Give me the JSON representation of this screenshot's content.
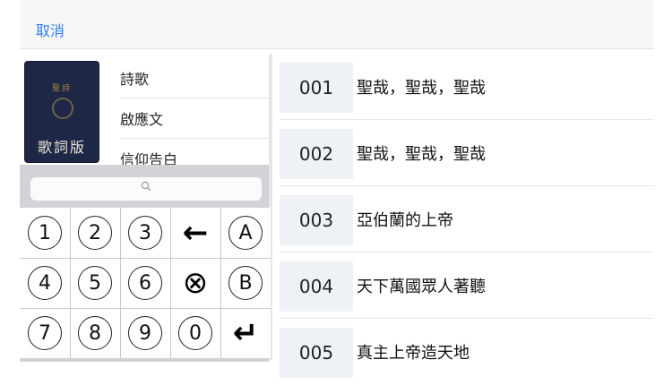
{
  "header": {
    "cancel_label": "取消"
  },
  "cover": {
    "top_text": "聖詩",
    "main_text": "歌詞版"
  },
  "menu": {
    "items": [
      "詩歌",
      "啟應文",
      "信仰告白"
    ]
  },
  "keypad": {
    "search_icon": "search-icon",
    "keys": [
      "1",
      "2",
      "3",
      "←",
      "A",
      "4",
      "5",
      "6",
      "⊗",
      "B",
      "7",
      "8",
      "9",
      "0",
      "↵"
    ]
  },
  "hymns": [
    {
      "num": "001",
      "title": "聖哉，聖哉，聖哉"
    },
    {
      "num": "002",
      "title": "聖哉，聖哉，聖哉"
    },
    {
      "num": "003",
      "title": "亞伯蘭的上帝"
    },
    {
      "num": "004",
      "title": "天下萬國眾人著聽"
    },
    {
      "num": "005",
      "title": "真主上帝造天地"
    }
  ],
  "colors": {
    "accent": "#2f7bf6",
    "cover": "#1f2746",
    "keypad_bg": "#d3d3d7"
  }
}
